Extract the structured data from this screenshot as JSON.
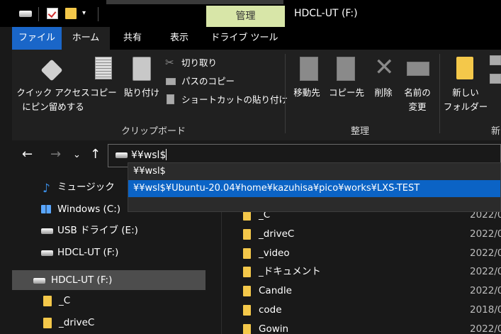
{
  "window": {
    "title": "HDCL-UT (F:)",
    "context_tab": "管理"
  },
  "ribbon_tabs": [
    "ファイル",
    "ホーム",
    "共有",
    "表示",
    "ドライブ ツール"
  ],
  "ribbon": {
    "clipboard": {
      "quick_access_line1": "クイック アクセス",
      "quick_access_line2": "にピン留めする",
      "copy": "コピー",
      "paste": "貼り付け",
      "cut": "切り取り",
      "copy_path": "パスのコピー",
      "paste_shortcut": "ショートカットの貼り付け",
      "label": "クリップボード"
    },
    "organize": {
      "move_to": "移動先",
      "copy_to": "コピー先",
      "delete": "削除",
      "rename_line1": "名前の",
      "rename_line2": "変更",
      "label": "整理"
    },
    "new": {
      "new_folder_line1": "新しい",
      "new_folder_line2": "フォルダー",
      "label_partial": "新"
    }
  },
  "address_bar": {
    "value": "¥¥wsl$"
  },
  "autocomplete": [
    "¥¥wsl$",
    "¥¥wsl$¥Ubuntu-20.04¥home¥kazuhisa¥pico¥works¥LXS-TEST"
  ],
  "nav_pane": {
    "items": [
      {
        "label": "ミュージック",
        "icon": "music-icon"
      },
      {
        "label": "Windows (C:)",
        "icon": "windows-drive-icon"
      },
      {
        "label": "USB ドライブ (E:)",
        "icon": "usb-drive-icon"
      },
      {
        "label": "HDCL-UT (F:)",
        "icon": "drive-icon"
      },
      {
        "label": "HDCL-UT (F:)",
        "icon": "drive-icon"
      },
      {
        "label": "_C",
        "icon": "folder-icon"
      },
      {
        "label": "_driveC",
        "icon": "folder-icon"
      }
    ]
  },
  "file_list": {
    "rows": [
      {
        "name": "_C",
        "date": "2022/0"
      },
      {
        "name": "_driveC",
        "date": "2022/0"
      },
      {
        "name": "_video",
        "date": "2022/0"
      },
      {
        "name": "_ドキュメント",
        "date": "2022/0"
      },
      {
        "name": "Candle",
        "date": "2022/0"
      },
      {
        "name": "code",
        "date": "2018/0"
      },
      {
        "name": "Gowin",
        "date": "2022/0"
      }
    ]
  },
  "colors": {
    "accent_blue": "#1a66c8",
    "selection_blue": "#0b63c5",
    "manage_tab_green": "#d8e6a8",
    "folder_yellow": "#f4c84a"
  }
}
